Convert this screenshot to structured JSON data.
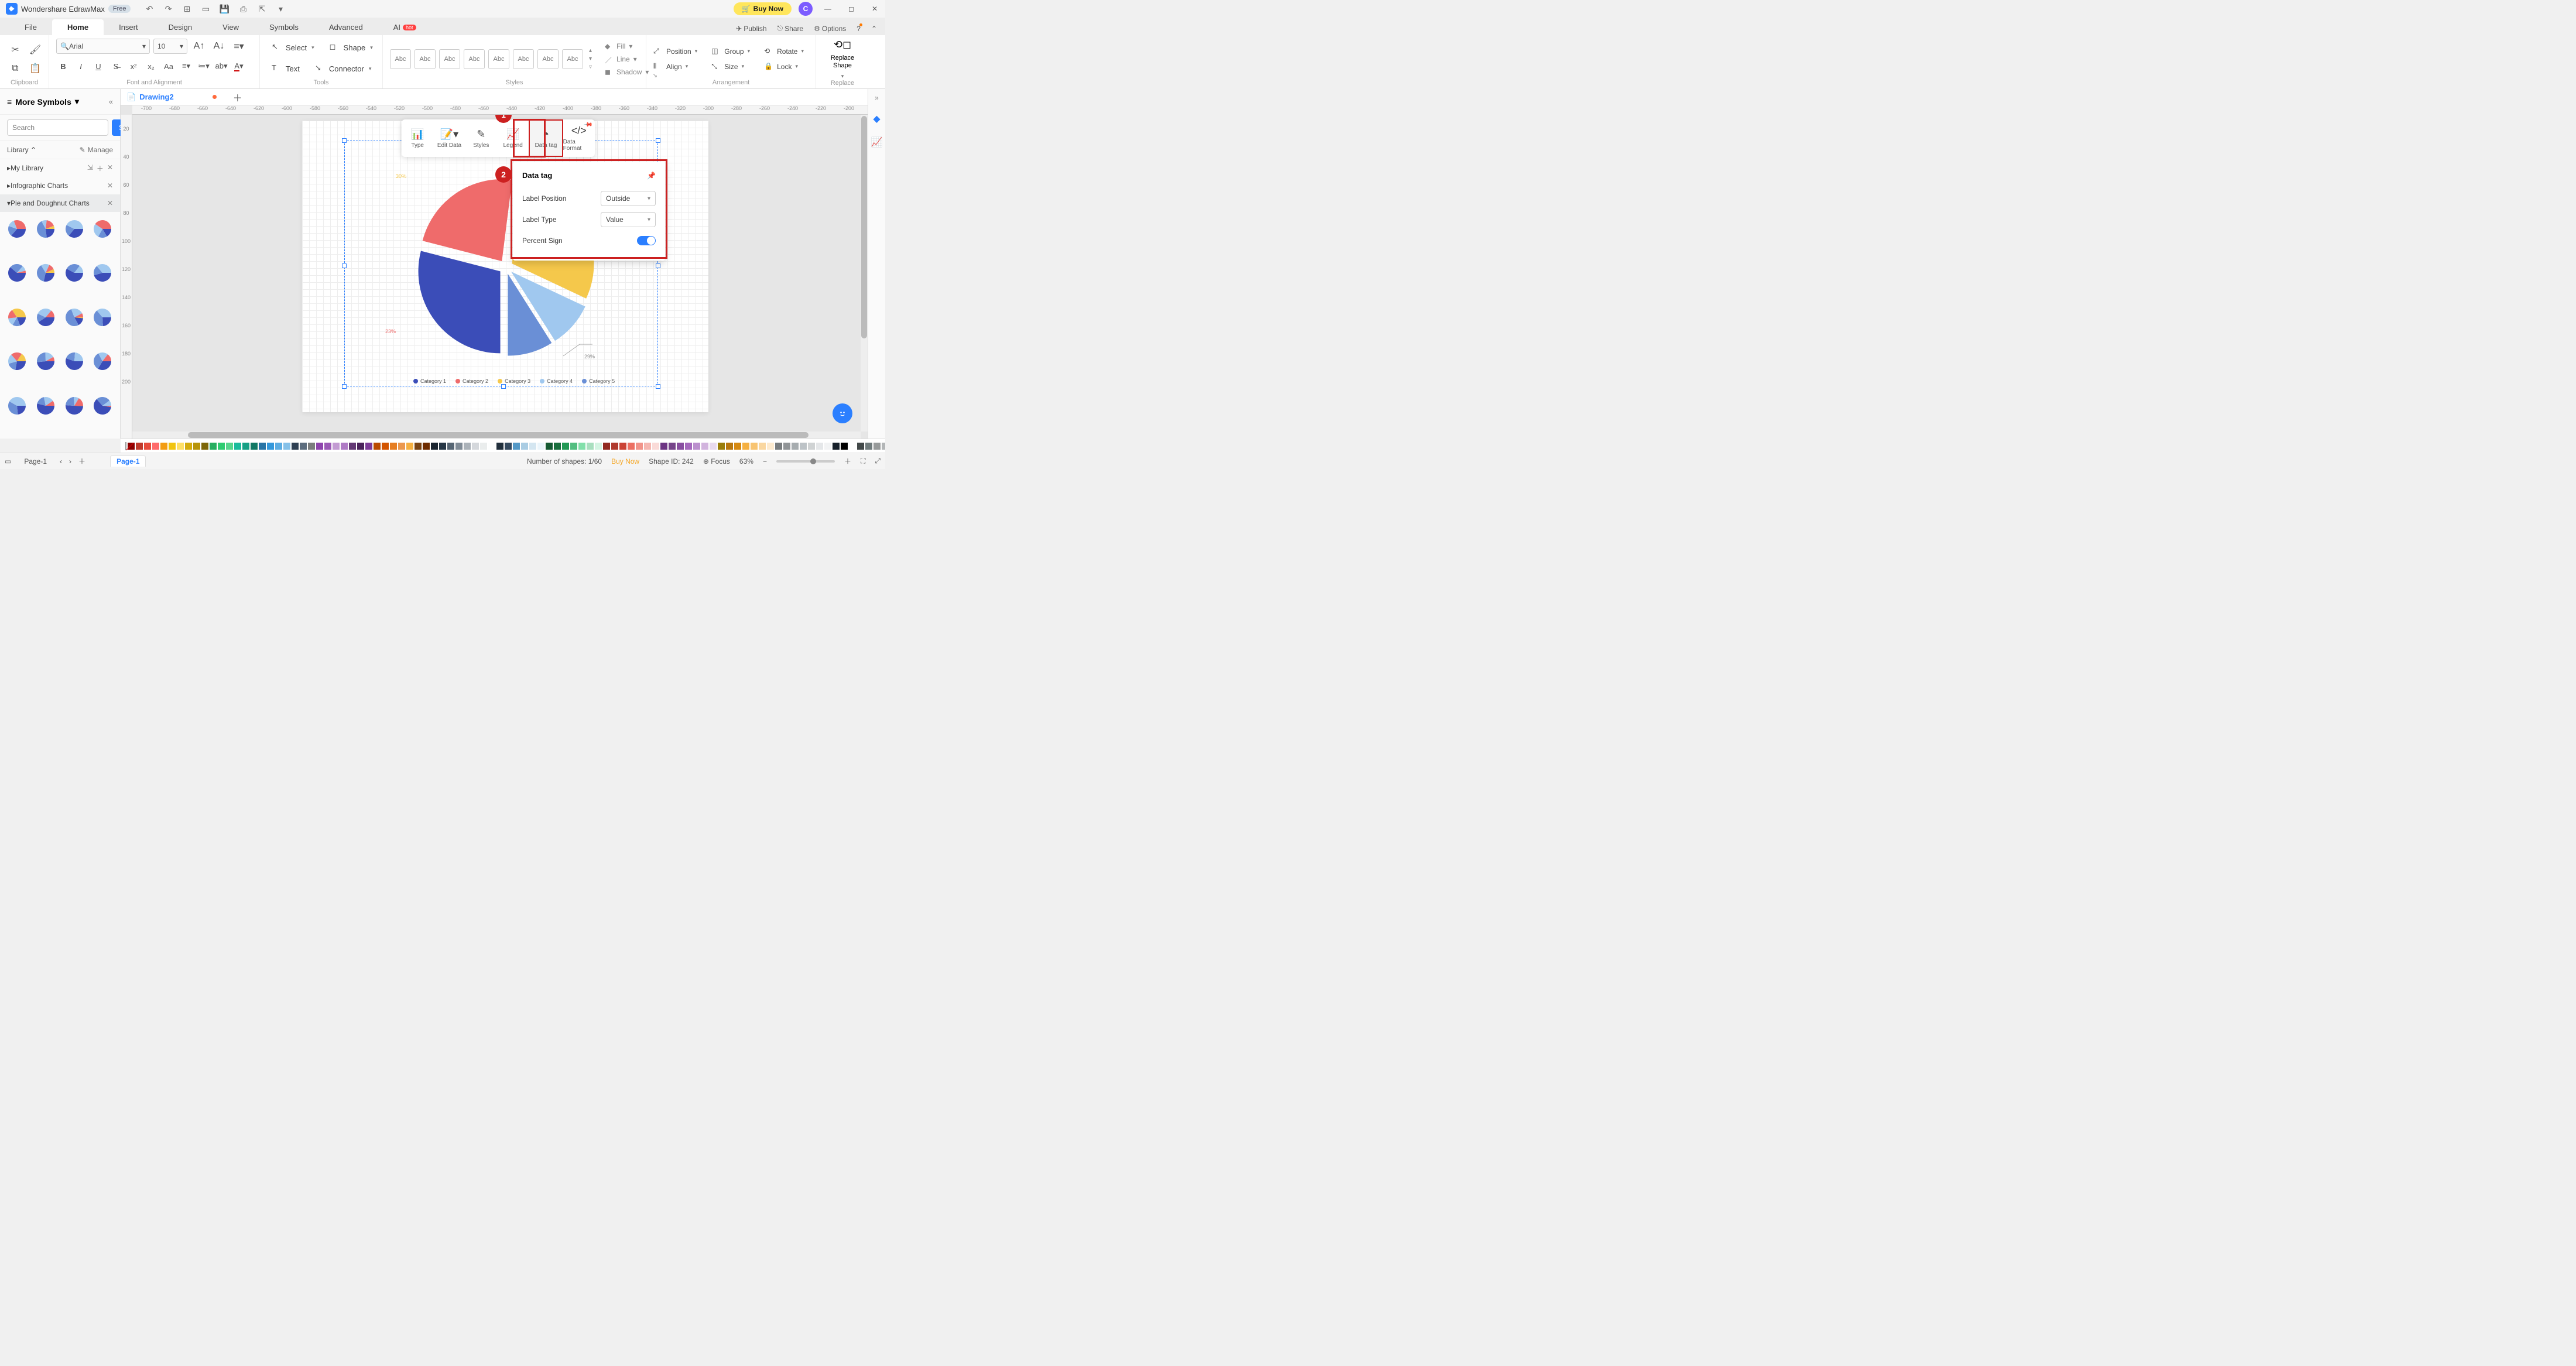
{
  "app": {
    "title": "Wondershare EdrawMax",
    "free_badge": "Free",
    "avatar_letter": "C",
    "buy_now": "Buy Now"
  },
  "menu": {
    "items": [
      "File",
      "Home",
      "Insert",
      "Design",
      "View",
      "Symbols",
      "Advanced",
      "AI"
    ],
    "active": 1,
    "hot": "hot",
    "right": {
      "publish": "Publish",
      "share": "Share",
      "options": "Options"
    }
  },
  "ribbon": {
    "clipboard": "Clipboard",
    "font_align": "Font and Alignment",
    "font_name": "Arial",
    "font_size": "10",
    "tools": "Tools",
    "select": "Select",
    "text": "Text",
    "shape": "Shape",
    "connector": "Connector",
    "styles": "Styles",
    "style_label": "Abc",
    "props": {
      "fill": "Fill",
      "line": "Line",
      "shadow": "Shadow"
    },
    "arrangement": "Arrangement",
    "arr": {
      "position": "Position",
      "align": "Align",
      "group": "Group",
      "size": "Size",
      "rotate": "Rotate",
      "lock": "Lock"
    },
    "replace": "Replace",
    "replace_shape": "Replace\nShape"
  },
  "left": {
    "more_symbols": "More Symbols",
    "search_ph": "Search",
    "search_btn": "Search",
    "library": "Library",
    "manage": "Manage",
    "mylib": "My Library",
    "cat1": "Infographic Charts",
    "cat2": "Pie and Doughnut Charts"
  },
  "tab": {
    "name": "Drawing2"
  },
  "hruler": [
    "-700",
    "-680",
    "-660",
    "-640",
    "-620",
    "-600",
    "-580",
    "-560",
    "-540",
    "-520",
    "-500",
    "-480",
    "-460",
    "-440",
    "-420",
    "-400",
    "-380",
    "-360",
    "-340",
    "-320",
    "-300",
    "-280",
    "-260",
    "-240",
    "-220",
    "-200"
  ],
  "vruler": [
    "20",
    "40",
    "60",
    "80",
    "100",
    "120",
    "140",
    "160",
    "180",
    "200"
  ],
  "chart_data": {
    "type": "pie",
    "categories": [
      "Category 1",
      "Category 2",
      "Category 3",
      "Category 4",
      "Category 5"
    ],
    "values": [
      29,
      23,
      30,
      9,
      9
    ],
    "colors": [
      "#3b4db8",
      "#ef6b6b",
      "#f5c84b",
      "#a0c8ef",
      "#6a8fd6"
    ],
    "title": "",
    "exploded": true,
    "visible_labels": [
      {
        "cat": "Category 1",
        "text": "29%"
      },
      {
        "cat": "Category 2",
        "text": "23%"
      },
      {
        "cat": "Category 3",
        "text": "30%"
      }
    ]
  },
  "legend": [
    {
      "label": "Category 1",
      "color": "#3b4db8"
    },
    {
      "label": "Category 2",
      "color": "#ef6b6b"
    },
    {
      "label": "Category 3",
      "color": "#f5c84b"
    },
    {
      "label": "Category 4",
      "color": "#a0c8ef"
    },
    {
      "label": "Category 5",
      "color": "#6a8fd6"
    }
  ],
  "float_tb": {
    "type": "Type",
    "edit": "Edit Data",
    "styles": "Styles",
    "legend": "Legend",
    "datatag": "Data tag",
    "dataformat": "Data Format"
  },
  "badges": {
    "one": "1",
    "two": "2"
  },
  "popover": {
    "title": "Data tag",
    "label_pos": "Label Position",
    "label_pos_v": "Outside",
    "label_type": "Label Type",
    "label_type_v": "Value",
    "percent": "Percent Sign"
  },
  "status": {
    "page": "Page-1",
    "shapes": "Number of shapes: 1/60",
    "buy": "Buy Now",
    "shape_id": "Shape ID: 242",
    "focus": "Focus",
    "zoom": "63%"
  },
  "color_swatches": [
    "#8b0000",
    "#c0392b",
    "#e74c3c",
    "#ff6b6b",
    "#f39c12",
    "#f1c40f",
    "#ffe066",
    "#d4ac0d",
    "#b7950b",
    "#7d6608",
    "#27ae60",
    "#2ecc71",
    "#58d68d",
    "#1abc9c",
    "#16a085",
    "#117864",
    "#2874a6",
    "#3498db",
    "#5dade2",
    "#85c1e9",
    "#2e4053",
    "#5d6d7e",
    "#7b7d7d",
    "#8e44ad",
    "#9b59b6",
    "#c39bd3",
    "#af7ac5",
    "#633974",
    "#4a235a",
    "#7d3c98",
    "#ba4a00",
    "#d35400",
    "#e67e22",
    "#eb984e",
    "#f5b041",
    "#784212",
    "#6e2c00",
    "#1b2631",
    "#273746",
    "#566573",
    "#808b96",
    "#abb2b9",
    "#d5d8dc",
    "#eaeded",
    "#fdfefe",
    "#212f3c",
    "#34495e",
    "#5499c7",
    "#a9cce3",
    "#d4e6f1",
    "#ebf5fb",
    "#145a32",
    "#196f3d",
    "#229954",
    "#52be80",
    "#82e0aa",
    "#a9dfbf",
    "#d5f5e3",
    "#922b21",
    "#b03a2e",
    "#cb4335",
    "#ec7063",
    "#f1948a",
    "#f5b7b1",
    "#fadbd8",
    "#6c3483",
    "#76448a",
    "#884ea0",
    "#a569bd",
    "#bb8fce",
    "#d2b4de",
    "#e8daef",
    "#9a7d0a",
    "#b9770e",
    "#d68910",
    "#f5b041",
    "#f8c471",
    "#fad7a0",
    "#fdebd0",
    "#797d7f",
    "#909497",
    "#a6acaf",
    "#bdc3c7",
    "#d0d3d4",
    "#e5e7e9",
    "#f2f3f4",
    "#17202a",
    "#000000",
    "#ffffff",
    "#424949",
    "#707b7c",
    "#979a9a",
    "#b3b6b7"
  ]
}
